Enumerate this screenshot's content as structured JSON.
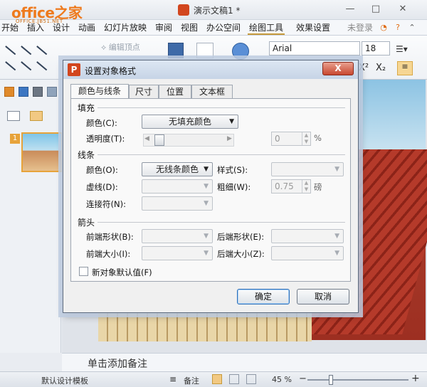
{
  "app": {
    "logo_text": "office之家",
    "logo_site": "OFFICE.JB51.NET",
    "window_title": "演示文稿1 *"
  },
  "ribbon_tabs": [
    {
      "label": "开始"
    },
    {
      "label": "插入"
    },
    {
      "label": "设计"
    },
    {
      "label": "动画"
    },
    {
      "label": "幻灯片放映"
    },
    {
      "label": "审阅"
    },
    {
      "label": "视图"
    },
    {
      "label": "办公空间"
    },
    {
      "label": "绘图工具"
    },
    {
      "label": "效果设置"
    },
    {
      "label": "未登录"
    }
  ],
  "ribbon": {
    "edit_vertex": "编辑顶点",
    "font_name": "Arial",
    "font_size": "18"
  },
  "notes_placeholder": "单击添加备注",
  "statusbar": {
    "template": "默认设计模板",
    "notes": "备注",
    "zoom": "45 %"
  },
  "dialog": {
    "title": "设置对象格式",
    "close_label": "X",
    "tabs": [
      {
        "label": "颜色与线条"
      },
      {
        "label": "尺寸"
      },
      {
        "label": "位置"
      },
      {
        "label": "文本框"
      }
    ],
    "fill": {
      "section": "填充",
      "color_label": "颜色(C):",
      "color_value": "无填充颜色",
      "transparency_label": "透明度(T):",
      "transparency_value": "0",
      "transparency_unit": "%"
    },
    "line": {
      "section": "线条",
      "color_label": "颜色(O):",
      "color_value": "无线条颜色",
      "style_label": "样式(S):",
      "dash_label": "虚线(D):",
      "weight_label": "粗细(W):",
      "weight_value": "0.75",
      "weight_unit": "磅",
      "connector_label": "连接符(N):"
    },
    "arrow": {
      "section": "箭头",
      "begin_style_label": "前端形状(B):",
      "end_style_label": "后端形状(E):",
      "begin_size_label": "前端大小(I):",
      "end_size_label": "后端大小(Z):"
    },
    "default_checkbox": "新对象默认值(F)",
    "ok": "确定",
    "cancel": "取消"
  }
}
